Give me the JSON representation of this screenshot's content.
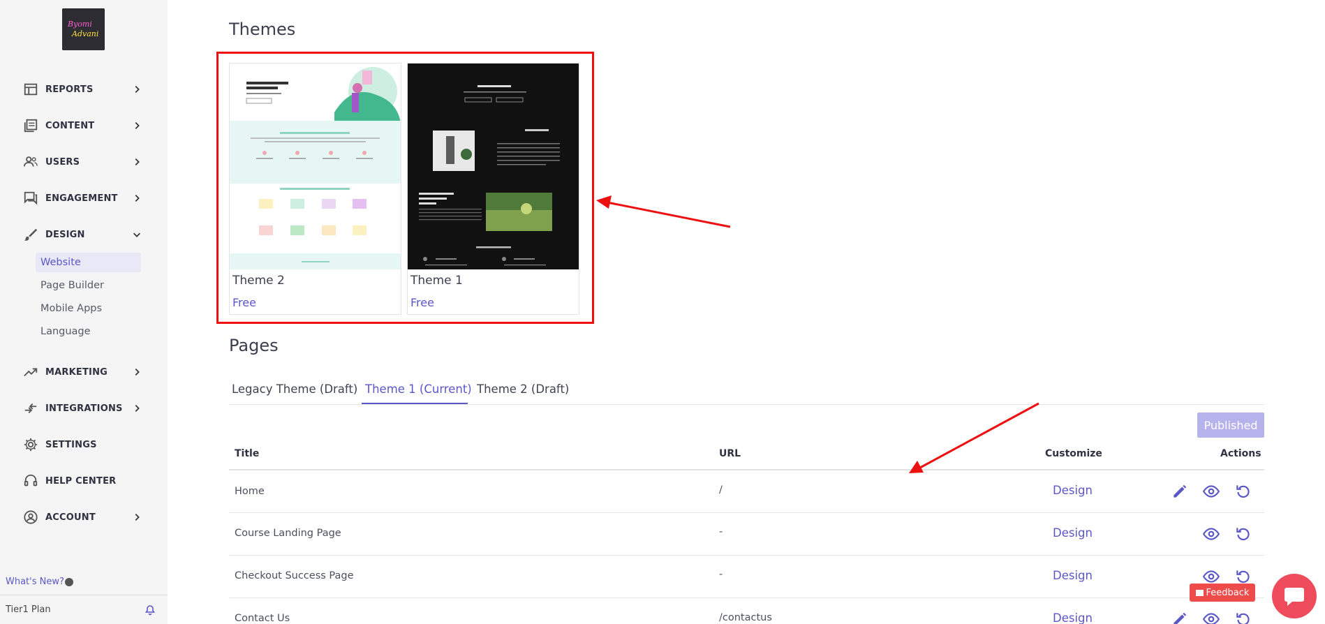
{
  "sidebar": {
    "logo_text": "Byomi Advani",
    "nav": [
      {
        "label": "REPORTS",
        "icon": "table-icon",
        "expanded": false
      },
      {
        "label": "CONTENT",
        "icon": "content-icon",
        "expanded": false
      },
      {
        "label": "USERS",
        "icon": "users-icon",
        "expanded": false
      },
      {
        "label": "ENGAGEMENT",
        "icon": "chat-icon",
        "expanded": false
      },
      {
        "label": "DESIGN",
        "icon": "brush-icon",
        "expanded": true
      },
      {
        "label": "MARKETING",
        "icon": "trending-icon",
        "expanded": false
      },
      {
        "label": "INTEGRATIONS",
        "icon": "integrations-icon",
        "expanded": false
      },
      {
        "label": "SETTINGS",
        "icon": "gear-icon",
        "expanded": false
      },
      {
        "label": "HELP CENTER",
        "icon": "headset-icon",
        "expanded": false
      },
      {
        "label": "ACCOUNT",
        "icon": "account-icon",
        "expanded": false
      }
    ],
    "design_sub": [
      "Website",
      "Page Builder",
      "Mobile Apps",
      "Language"
    ],
    "active_sub": "Website",
    "whats_new": "What's New?",
    "plan": "Tier1 Plan"
  },
  "themes": {
    "heading": "Themes",
    "items": [
      {
        "name": "Theme 2",
        "price": "Free"
      },
      {
        "name": "Theme 1",
        "price": "Free"
      }
    ]
  },
  "pages": {
    "heading": "Pages",
    "tabs": [
      "Legacy Theme (Draft)",
      "Theme 1 (Current)",
      "Theme 2 (Draft)"
    ],
    "active_tab": "Theme 1 (Current)",
    "status_button": "Published",
    "columns": {
      "title": "Title",
      "url": "URL",
      "customize": "Customize",
      "actions": "Actions"
    },
    "rows": [
      {
        "title": "Home",
        "url": "/",
        "customize": "Design",
        "edit": true
      },
      {
        "title": "Course Landing Page",
        "url": "-",
        "customize": "Design",
        "edit": false
      },
      {
        "title": "Checkout Success Page",
        "url": "-",
        "customize": "Design",
        "edit": false
      },
      {
        "title": "Contact Us",
        "url": "/contactus",
        "customize": "Design",
        "edit": true
      }
    ]
  },
  "feedback_label": "Feedback",
  "colors": {
    "accent": "#5a57c7",
    "annotation": "#ee1010",
    "sidebar_bg": "#f5f5f6"
  }
}
